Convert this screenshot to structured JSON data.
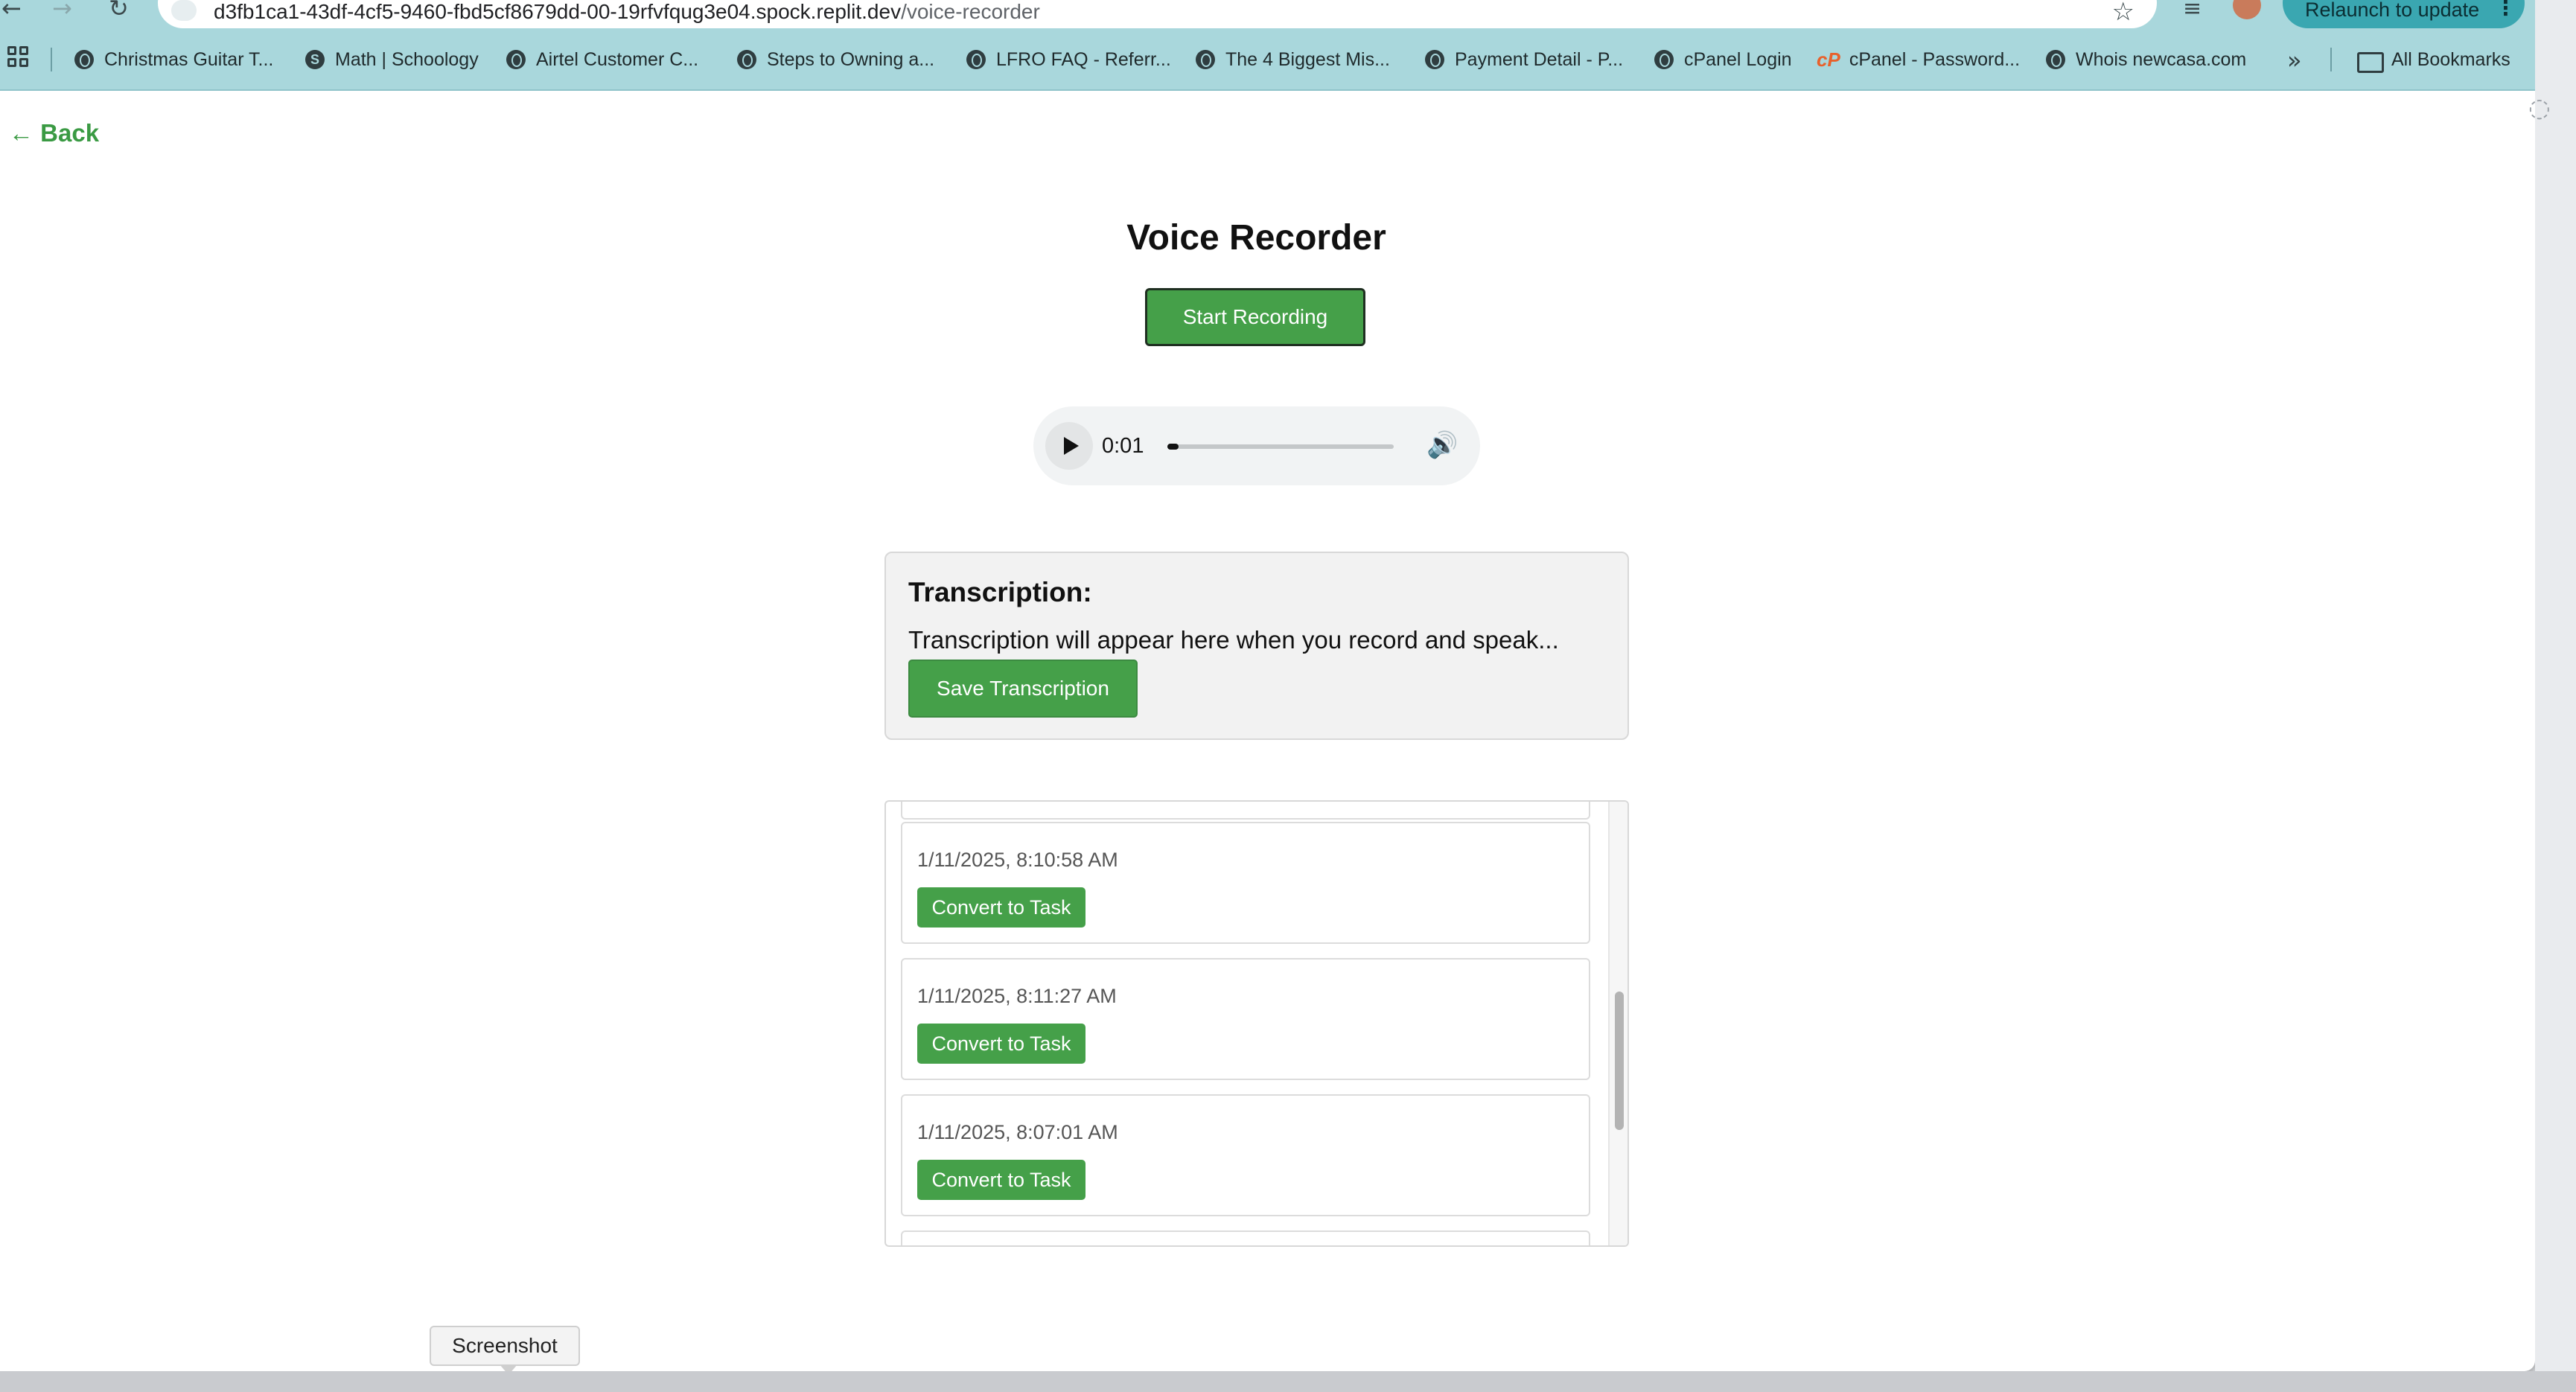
{
  "browser": {
    "url_host": "d3fb1ca1-43df-4cf5-9460-fbd5cf8679dd-00-19rfvfqug3e04.spock.replit.dev",
    "url_path": "/voice-recorder",
    "relaunch_label": "Relaunch to update",
    "bookmarks": [
      {
        "label": "Christmas Guitar T...",
        "icon": "globe-icon"
      },
      {
        "label": "Math | Schoology",
        "icon": "schoology-icon"
      },
      {
        "label": "Airtel Customer C...",
        "icon": "globe-icon"
      },
      {
        "label": "Steps to Owning a...",
        "icon": "globe-icon"
      },
      {
        "label": "LFRO FAQ - Referr...",
        "icon": "globe-icon"
      },
      {
        "label": "The 4 Biggest Mis...",
        "icon": "globe-icon"
      },
      {
        "label": "Payment Detail - P...",
        "icon": "globe-icon"
      },
      {
        "label": "cPanel Login",
        "icon": "globe-icon"
      },
      {
        "label": "cPanel - Password...",
        "icon": "cpanel-icon"
      },
      {
        "label": "Whois newcasa.com",
        "icon": "globe-icon"
      }
    ],
    "all_bookmarks_label": "All Bookmarks"
  },
  "page": {
    "back_label": "← Back",
    "title": "Voice Recorder",
    "start_button": "Start Recording",
    "player": {
      "time": "0:01",
      "progress_fraction": 0.05
    },
    "transcription": {
      "heading": "Transcription:",
      "placeholder_text": "Transcription will appear here when you record and speak...",
      "save_button": "Save Transcription"
    },
    "recordings": [
      {
        "timestamp": "1/11/2025, 8:10:58 AM",
        "button": "Convert to Task"
      },
      {
        "timestamp": "1/11/2025, 8:11:27 AM",
        "button": "Convert to Task"
      },
      {
        "timestamp": "1/11/2025, 8:07:01 AM",
        "button": "Convert to Task"
      }
    ]
  },
  "tooltip": "Screenshot",
  "colors": {
    "accent_green": "#45a049",
    "toolbar_teal": "#a9d7dc"
  }
}
